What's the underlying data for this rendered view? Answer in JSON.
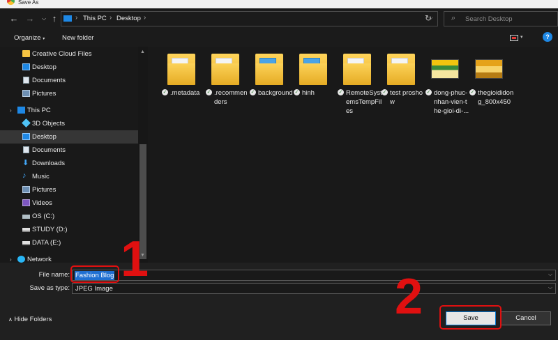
{
  "window": {
    "title": "Save As"
  },
  "nav": {
    "address": {
      "crumbs": [
        "This PC",
        "Desktop"
      ]
    },
    "search": {
      "placeholder": "Search Desktop"
    }
  },
  "toolbar": {
    "organize_label": "Organize",
    "new_folder_label": "New folder",
    "help_label": "?"
  },
  "sidebar": {
    "items": [
      {
        "label": "Creative Cloud Files",
        "icon": "folder-icon"
      },
      {
        "label": "Desktop",
        "icon": "desktop-icon"
      },
      {
        "label": "Documents",
        "icon": "documents-icon"
      },
      {
        "label": "Pictures",
        "icon": "pictures-icon"
      },
      {
        "label": "This PC",
        "icon": "pc-icon"
      },
      {
        "label": "3D Objects",
        "icon": "3d-objects-icon"
      },
      {
        "label": "Desktop",
        "icon": "desktop-icon",
        "selected": true
      },
      {
        "label": "Documents",
        "icon": "documents-icon"
      },
      {
        "label": "Downloads",
        "icon": "downloads-icon"
      },
      {
        "label": "Music",
        "icon": "music-icon"
      },
      {
        "label": "Pictures",
        "icon": "pictures-icon"
      },
      {
        "label": "Videos",
        "icon": "videos-icon"
      },
      {
        "label": "OS (C:)",
        "icon": "drive-icon"
      },
      {
        "label": "STUDY (D:)",
        "icon": "drive-icon"
      },
      {
        "label": "DATA (E:)",
        "icon": "drive-icon"
      },
      {
        "label": "Network",
        "icon": "network-icon"
      }
    ]
  },
  "files": [
    {
      "name": ".metadata",
      "type": "folder"
    },
    {
      "name": ".recommenders",
      "type": "folder"
    },
    {
      "name": "background",
      "type": "folder"
    },
    {
      "name": "hinh",
      "type": "folder"
    },
    {
      "name": "RemoteSystemsTempFiles",
      "type": "folder"
    },
    {
      "name": "test proshow",
      "type": "folder"
    },
    {
      "name": "dong-phuc-nhan-vien-the-gioi-di-...",
      "type": "image"
    },
    {
      "name": "thegioididong_800x450",
      "type": "image"
    }
  ],
  "form": {
    "file_name_label": "File name:",
    "file_name_value": "Fashion Blog",
    "save_type_label": "Save as type:",
    "save_type_value": "JPEG Image"
  },
  "footer": {
    "hide_folders_label": "Hide Folders",
    "save_label": "Save",
    "cancel_label": "Cancel"
  },
  "annotations": {
    "step1": "1",
    "step2": "2",
    "color": "#e01010"
  }
}
